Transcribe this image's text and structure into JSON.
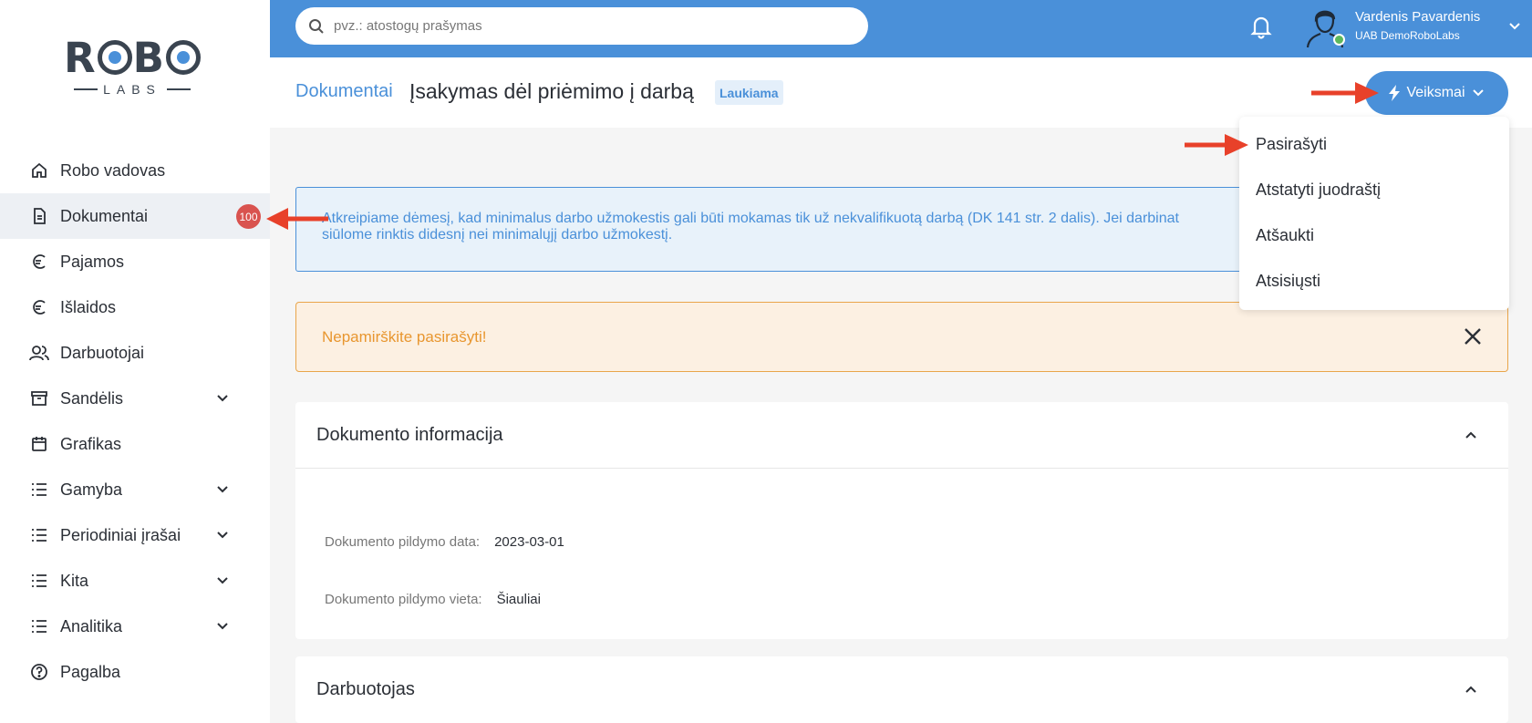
{
  "brand": {
    "logo_top": "ROBO",
    "logo_bottom": "LABS"
  },
  "sidebar": {
    "items": [
      {
        "label": "Robo vadovas",
        "icon": "home-icon",
        "expandable": false
      },
      {
        "label": "Dokumentai",
        "icon": "document-icon",
        "expandable": false,
        "active": true,
        "badge": "100"
      },
      {
        "label": "Pajamos",
        "icon": "euro-icon",
        "expandable": false
      },
      {
        "label": "Išlaidos",
        "icon": "euro-icon",
        "expandable": false
      },
      {
        "label": "Darbuotojai",
        "icon": "users-icon",
        "expandable": false
      },
      {
        "label": "Sandėlis",
        "icon": "archive-icon",
        "expandable": true
      },
      {
        "label": "Grafikas",
        "icon": "calendar-icon",
        "expandable": false
      },
      {
        "label": "Gamyba",
        "icon": "list-icon",
        "expandable": true
      },
      {
        "label": "Periodiniai įrašai",
        "icon": "list-icon",
        "expandable": true
      },
      {
        "label": "Kita",
        "icon": "list-icon",
        "expandable": true
      },
      {
        "label": "Analitika",
        "icon": "list-icon",
        "expandable": true
      },
      {
        "label": "Pagalba",
        "icon": "help-icon",
        "expandable": false
      }
    ]
  },
  "topbar": {
    "search_placeholder": "pvz.: atostogų prašymas",
    "user_name": "Vardenis Pavardenis",
    "user_company": "UAB DemoRoboLabs"
  },
  "header": {
    "breadcrumb": "Dokumentai",
    "title": "Įsakymas dėl priėmimo į darbą",
    "status": "Laukiama",
    "actions_label": "Veiksmai"
  },
  "dropdown": {
    "items": [
      "Pasirašyti",
      "Atstatyti juodraštį",
      "Atšaukti",
      "Atsisiųsti"
    ]
  },
  "alerts": {
    "info_line1": "Atkreipiame dėmesį, kad minimalus darbo užmokestis gali būti mokamas tik už nekvalifikuotą darbą (DK 141 str. 2 dalis). Jei darbinat",
    "info_line2": "siūlome rinktis didesnį nei minimalųjį darbo užmokestį.",
    "warning": "Nepamirškite pasirašyti!"
  },
  "document_info": {
    "title": "Dokumento informacija",
    "date_label": "Dokumento pildymo data:",
    "date_value": "2023-03-01",
    "place_label": "Dokumento pildymo vieta:",
    "place_value": "Šiauliai"
  },
  "employee_card": {
    "title": "Darbuotojas"
  },
  "colors": {
    "primary": "#4a90d9",
    "warning": "#e8962f",
    "badge": "#d9534f",
    "arrow": "#e8412a"
  }
}
